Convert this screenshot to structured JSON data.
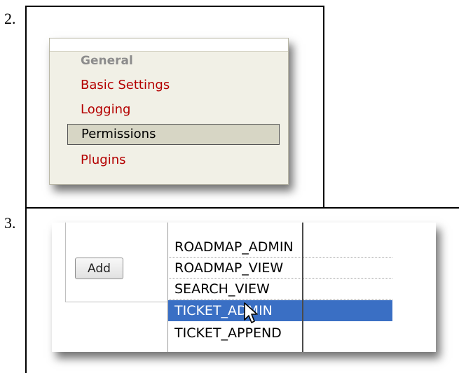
{
  "steps": {
    "step2": "2.",
    "step3": "3."
  },
  "nav": {
    "group_title": "General",
    "items": [
      {
        "label": "Basic Settings",
        "active": false
      },
      {
        "label": "Logging",
        "active": false
      },
      {
        "label": "Permissions",
        "active": true
      },
      {
        "label": "Plugins",
        "active": false
      }
    ]
  },
  "permissions": {
    "add_label": "Add",
    "options": [
      {
        "label": "ROADMAP_ADMIN",
        "selected": false
      },
      {
        "label": "ROADMAP_VIEW",
        "selected": false
      },
      {
        "label": "SEARCH_VIEW",
        "selected": false
      },
      {
        "label": "TICKET_ADMIN",
        "selected": true
      },
      {
        "label": "TICKET_APPEND",
        "selected": false
      }
    ]
  },
  "colors": {
    "link": "#b40000",
    "nav_background": "#f1f0e6",
    "nav_active": "#d7d6c5",
    "selection": "#3a6fc4",
    "group_title": "#8c8c8c"
  },
  "icons": {
    "cursor": "mouse-pointer-icon"
  }
}
